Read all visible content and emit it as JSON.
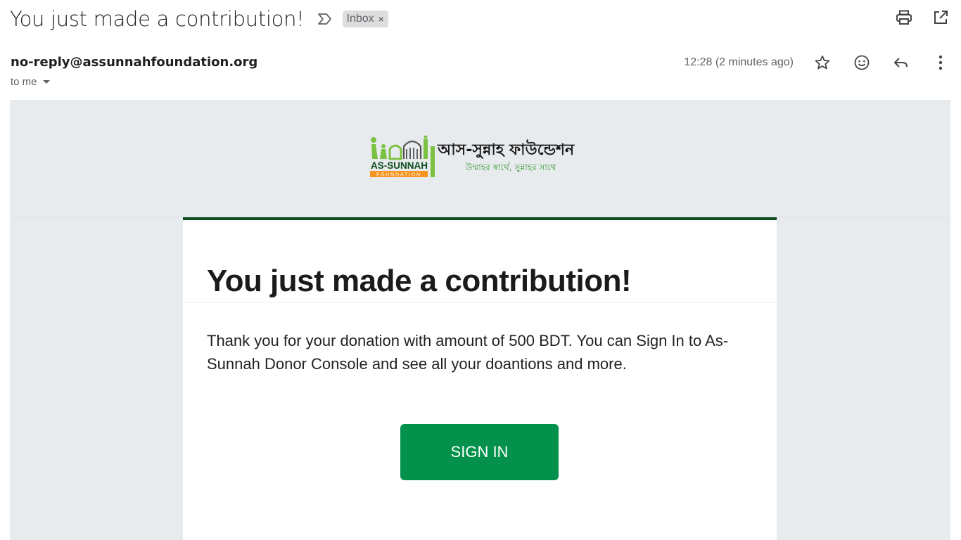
{
  "email": {
    "subject": "You just made a contribution!",
    "label": "Inbox",
    "label_remove": "×",
    "sender": "no-reply@assunnahfoundation.org",
    "recipient": "to me",
    "timestamp": "12:28 (2 minutes ago)"
  },
  "icons": {
    "importance": "importance-marker-icon",
    "print": "print-icon",
    "open_new_window": "open-in-new-window-icon",
    "star": "star-icon",
    "emoji": "emoji-reaction-icon",
    "reply": "reply-icon",
    "more": "more-options-icon",
    "dropdown": "caret-down-icon"
  },
  "content": {
    "logo": {
      "brand_en": "AS-SUNNAH",
      "brand_sub": "FOUNDATION",
      "brand_bn": "আস-সুন্নাহ ফাউন্ডেশন",
      "tagline_bn": "উম্মাহর স্বার্থে, সুন্নাহর সাথে"
    },
    "title": "You just made a contribution!",
    "body": "Thank you for your donation with amount of 500 BDT. You can Sign In to As-Sunnah Donor Console and see all your doantions and more.",
    "button": "SIGN IN"
  },
  "colors": {
    "accent_green": "#03914b",
    "header_bar": "#0e4d1f",
    "logo_green": "#7cc242",
    "logo_orange": "#f7941d",
    "mail_bg": "#e8ebee"
  }
}
